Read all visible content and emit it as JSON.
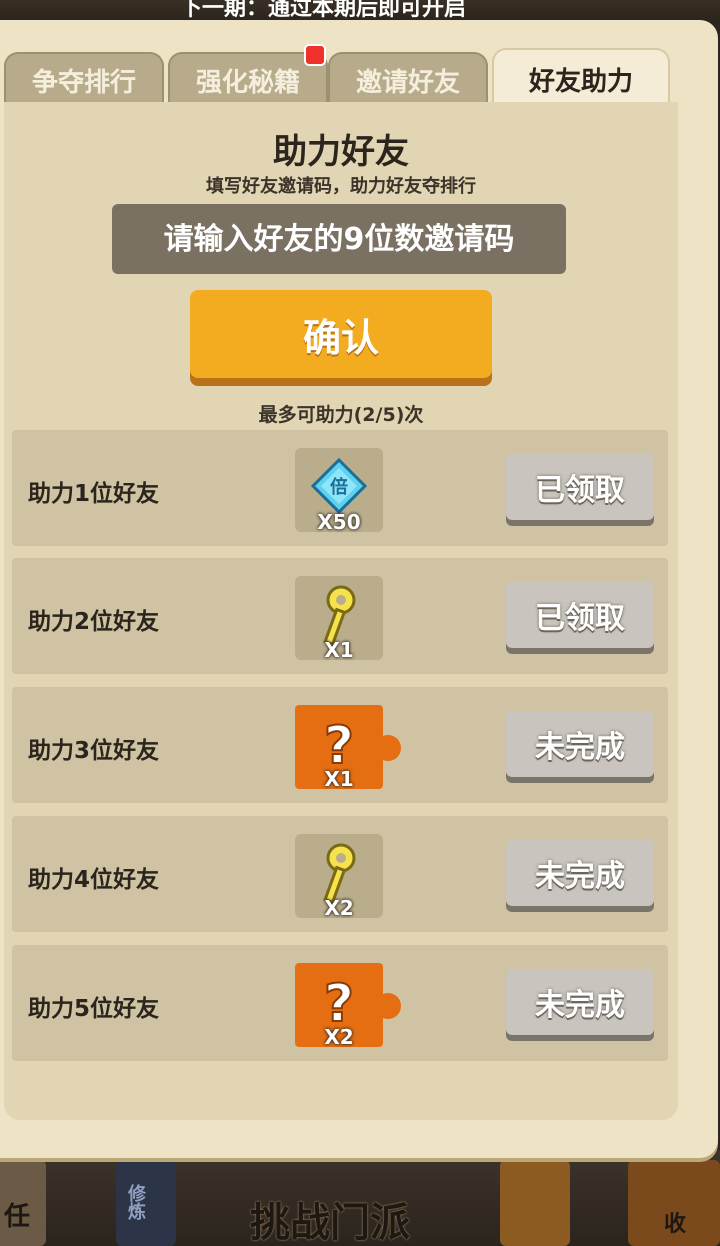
{
  "top_banner": "下一期：通过本期后即可开启",
  "tabs": [
    {
      "label": "争夺排行"
    },
    {
      "label": "强化秘籍"
    },
    {
      "label": "邀请好友"
    },
    {
      "label": "好友助力",
      "active": true
    }
  ],
  "panel": {
    "title": "助力好友",
    "subtitle": "填写好友邀请码，助力好友夺排行",
    "input_placeholder": "请输入好友的9位数邀请码",
    "confirm_label": "确认",
    "limit_text": "最多可助力(2/5)次"
  },
  "rewards": [
    {
      "label": "助力1位好友",
      "item": "diamond-multiplier-icon",
      "qty": "X50",
      "status": "已领取"
    },
    {
      "label": "助力2位好友",
      "item": "key-icon",
      "qty": "X1",
      "status": "已领取"
    },
    {
      "label": "助力3位好友",
      "item": "mystery-puzzle-icon",
      "qty": "X1",
      "status": "未完成"
    },
    {
      "label": "助力4位好友",
      "item": "key-icon",
      "qty": "X2",
      "status": "未完成"
    },
    {
      "label": "助力5位好友",
      "item": "mystery-puzzle-icon",
      "qty": "X2",
      "status": "未完成"
    }
  ],
  "bottom_bar": {
    "title": "挑战门派",
    "slot_1": "任",
    "slot_2": "修炼",
    "slot_3": "收"
  },
  "colors": {
    "accent": "#f3ac20",
    "panel": "#efe3c6",
    "row": "#cfc3a3",
    "disabled_button": "#c9c5be",
    "mystery_orange": "#e56d12"
  }
}
